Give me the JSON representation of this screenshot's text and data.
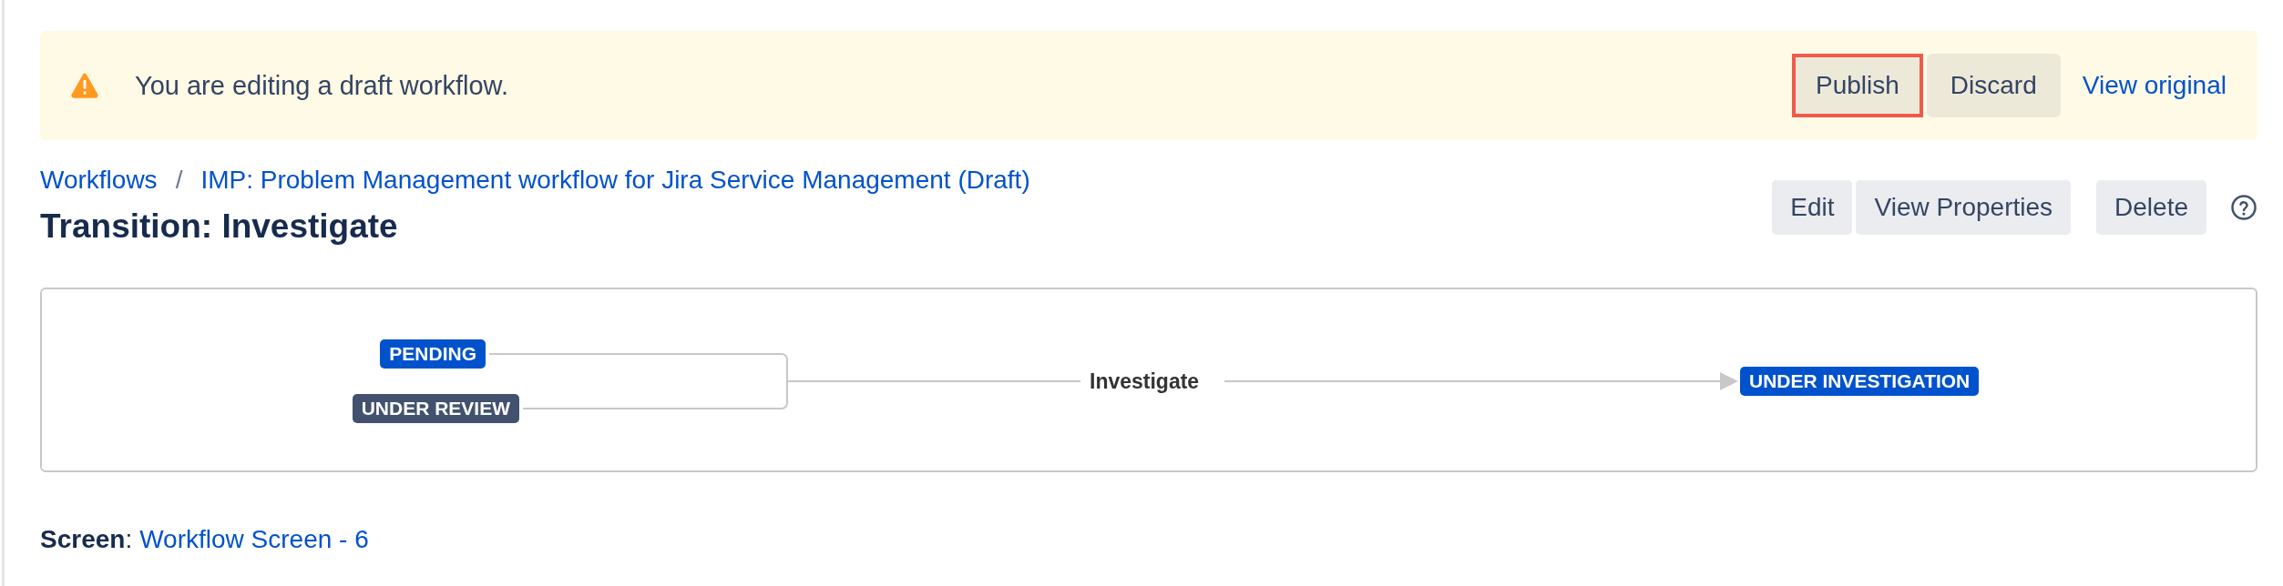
{
  "banner": {
    "message": "You are editing a draft workflow.",
    "buttons": [
      {
        "label": "Publish",
        "highlighted": true
      },
      {
        "label": "Discard",
        "highlighted": false
      }
    ],
    "link": "View original"
  },
  "breadcrumbs": [
    "Workflows",
    "IMP: Problem Management workflow for Jira Service Management (Draft)"
  ],
  "breadcrumb_separator": "/",
  "title": "Transition: Investigate",
  "actions": [
    {
      "label": "Edit"
    },
    {
      "label": "View Properties"
    },
    {
      "label": "Delete"
    }
  ],
  "diagram": {
    "from": [
      {
        "label": "PENDING",
        "color": "#0052cc"
      },
      {
        "label": "UNDER REVIEW",
        "color": "#42526e"
      }
    ],
    "transition": "Investigate",
    "to": {
      "label": "UNDER INVESTIGATION",
      "color": "#0052cc"
    }
  },
  "screen": {
    "label": "Screen",
    "separator": ":",
    "value": "Workflow Screen - 6"
  }
}
